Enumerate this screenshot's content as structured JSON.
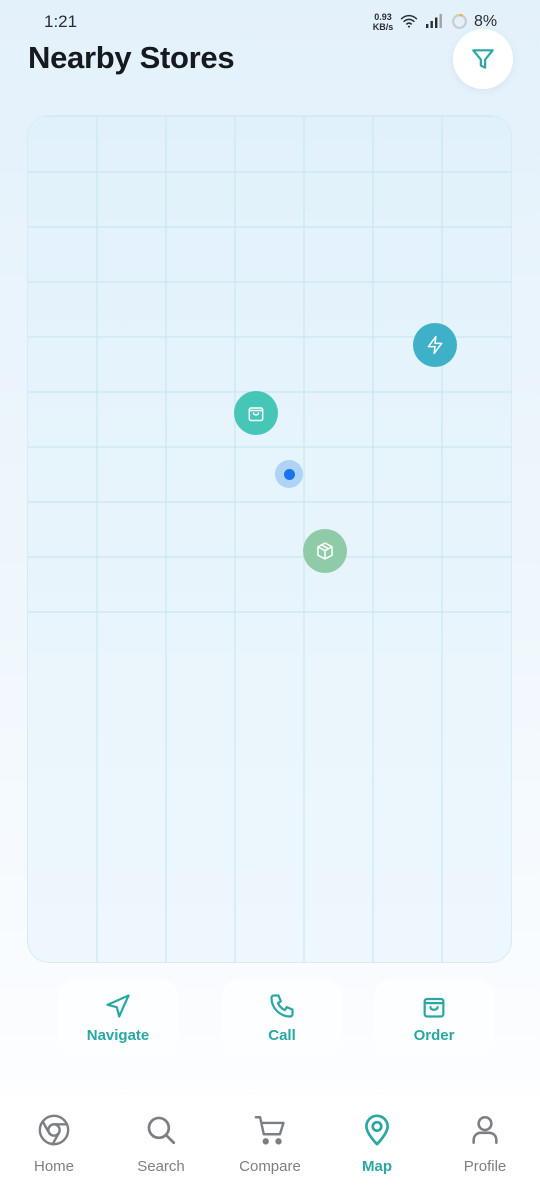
{
  "status_bar": {
    "time": "1:21",
    "net_speed_value": "0.93",
    "net_speed_unit": "KB/s",
    "battery_percent": "8%",
    "icons": [
      "wifi-icon",
      "signal-icon",
      "battery-icon"
    ]
  },
  "header": {
    "title": "Nearby Stores",
    "filter_icon": "filter-icon"
  },
  "map": {
    "markers": [
      {
        "name": "store-marker-quick",
        "icon": "lightning-icon",
        "color": "#3eb1c8"
      },
      {
        "name": "store-marker-shop",
        "icon": "shopping-bag-icon",
        "color": "#46c6b6"
      },
      {
        "name": "store-marker-parcel",
        "icon": "package-icon",
        "color": "#8fcba8"
      }
    ],
    "user_location_color": "#1a73e8"
  },
  "actions": [
    {
      "label": "Navigate",
      "icon": "navigate-icon"
    },
    {
      "label": "Call",
      "icon": "phone-icon"
    },
    {
      "label": "Order",
      "icon": "shopping-bag-icon"
    }
  ],
  "bottom_nav": {
    "items": [
      {
        "label": "Home",
        "icon": "chrome-icon",
        "active": false
      },
      {
        "label": "Search",
        "icon": "search-icon",
        "active": false
      },
      {
        "label": "Compare",
        "icon": "cart-icon",
        "active": false
      },
      {
        "label": "Map",
        "icon": "map-pin-icon",
        "active": true
      },
      {
        "label": "Profile",
        "icon": "user-icon",
        "active": false
      }
    ]
  },
  "colors": {
    "accent": "#2aa7a4",
    "inactive": "#7b7f84",
    "title": "#16191d"
  }
}
